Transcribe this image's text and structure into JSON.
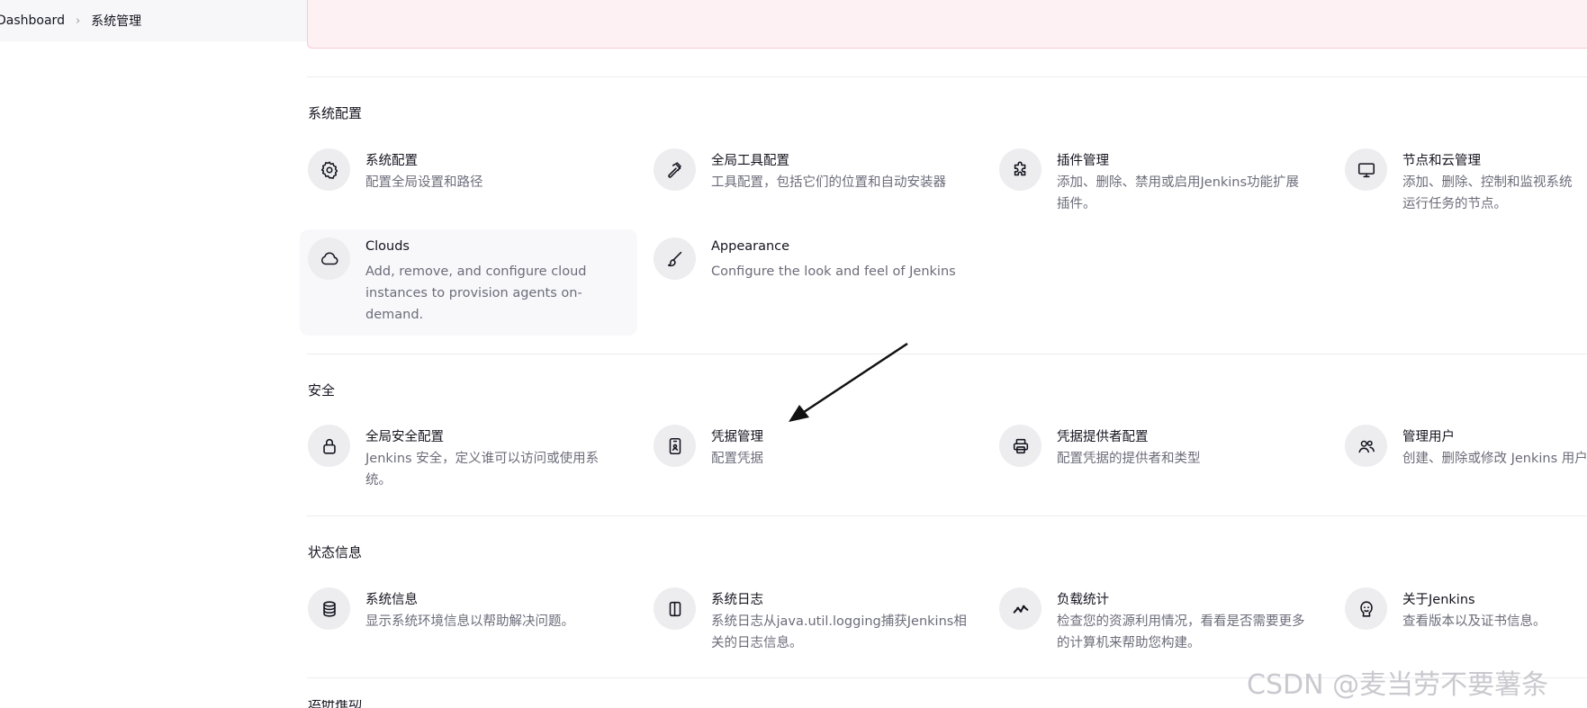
{
  "breadcrumb": {
    "root": "Dashboard",
    "current": "系统管理"
  },
  "sections": {
    "config": {
      "title": "系统配置",
      "items": [
        {
          "title": "系统配置",
          "desc": "配置全局设置和路径"
        },
        {
          "title": "全局工具配置",
          "desc": "工具配置，包括它们的位置和自动安装器"
        },
        {
          "title": "插件管理",
          "desc": "添加、删除、禁用或启用Jenkins功能扩展插件。"
        },
        {
          "title": "节点和云管理",
          "desc": "添加、删除、控制和监视系统运行任务的节点。"
        },
        {
          "title": "Clouds",
          "desc": "Add, remove, and configure cloud instances to provision agents on-demand."
        },
        {
          "title": "Appearance",
          "desc": "Configure the look and feel of Jenkins"
        }
      ]
    },
    "security": {
      "title": "安全",
      "items": [
        {
          "title": "全局安全配置",
          "desc": "Jenkins 安全，定义谁可以访问或使用系统。"
        },
        {
          "title": "凭据管理",
          "desc": "配置凭据"
        },
        {
          "title": "凭据提供者配置",
          "desc": "配置凭据的提供者和类型"
        },
        {
          "title": "管理用户",
          "desc": "创建、删除或修改 Jenkins 用户"
        }
      ]
    },
    "status": {
      "title": "状态信息",
      "items": [
        {
          "title": "系统信息",
          "desc": "显示系统环境信息以帮助解决问题。"
        },
        {
          "title": "系统日志",
          "desc": "系统日志从java.util.logging捕获Jenkins相关的日志信息。"
        },
        {
          "title": "负载统计",
          "desc": "检查您的资源利用情况，看看是否需要更多的计算机来帮助您构建。"
        },
        {
          "title": "关于Jenkins",
          "desc": "查看版本以及证书信息。"
        }
      ]
    },
    "next": {
      "title": "运研推动"
    }
  },
  "watermark": "CSDN @麦当劳不要薯条"
}
